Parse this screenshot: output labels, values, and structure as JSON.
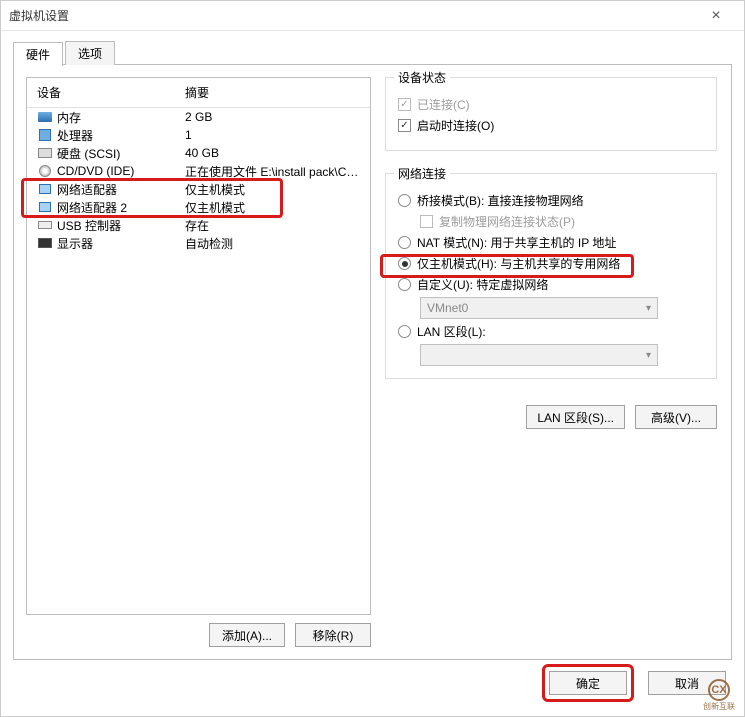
{
  "window": {
    "title": "虚拟机设置"
  },
  "tabs": {
    "hardware": "硬件",
    "options": "选项"
  },
  "list": {
    "head_device": "设备",
    "head_summary": "摘要",
    "rows": [
      {
        "name": "内存",
        "summary": "2 GB"
      },
      {
        "name": "处理器",
        "summary": "1"
      },
      {
        "name": "硬盘 (SCSI)",
        "summary": "40 GB"
      },
      {
        "name": "CD/DVD (IDE)",
        "summary": "正在使用文件 E:\\install pack\\Ce..."
      },
      {
        "name": "网络适配器",
        "summary": "仅主机模式"
      },
      {
        "name": "网络适配器 2",
        "summary": "仅主机模式"
      },
      {
        "name": "USB 控制器",
        "summary": "存在"
      },
      {
        "name": "显示器",
        "summary": "自动检测"
      }
    ]
  },
  "left_buttons": {
    "add": "添加(A)...",
    "remove": "移除(R)"
  },
  "status_group": {
    "title": "设备状态",
    "connected": "已连接(C)",
    "connect_on_power": "启动时连接(O)"
  },
  "net_group": {
    "title": "网络连接",
    "bridged": "桥接模式(B): 直接连接物理网络",
    "replicate": "复制物理网络连接状态(P)",
    "nat": "NAT 模式(N): 用于共享主机的 IP 地址",
    "hostonly": "仅主机模式(H): 与主机共享的专用网络",
    "custom": "自定义(U): 特定虚拟网络",
    "custom_value": "VMnet0",
    "lan": "LAN 区段(L):",
    "lan_value": ""
  },
  "right_buttons": {
    "lan": "LAN 区段(S)...",
    "adv": "高级(V)..."
  },
  "footer": {
    "ok": "确定",
    "cancel": "取消"
  },
  "logo_text": "创新互联"
}
